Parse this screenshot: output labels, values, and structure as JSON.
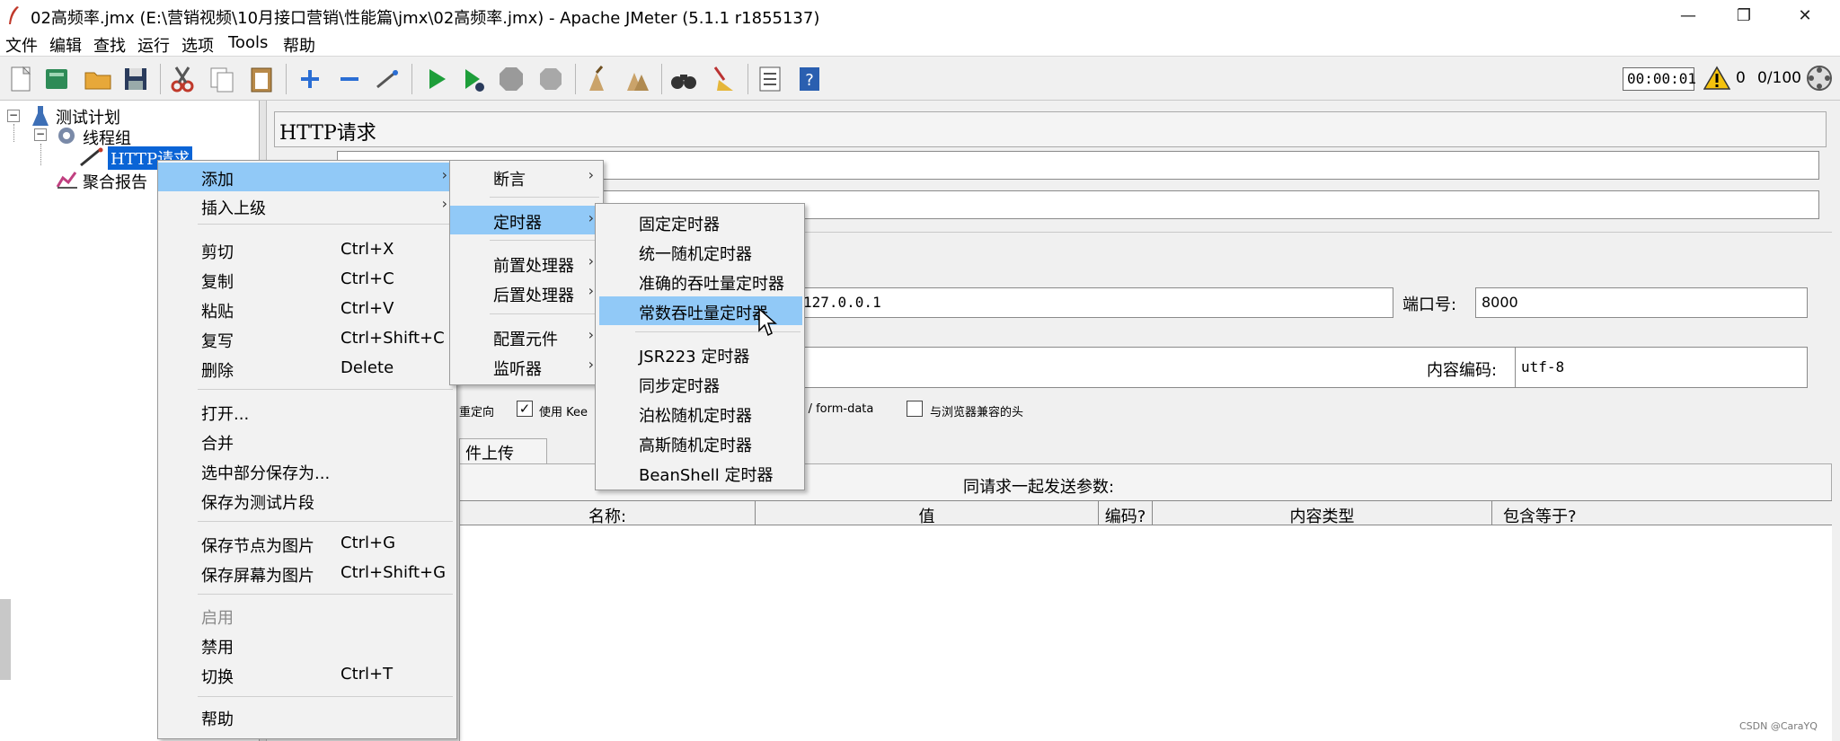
{
  "window": {
    "title": "02高频率.jmx (E:\\营销视频\\10月接口营销\\性能篇\\jmx\\02高频率.jmx) - Apache JMeter (5.1.1 r1855137)",
    "minimize": "—",
    "maximize": "❐",
    "close": "✕"
  },
  "menubar": [
    "文件",
    "编辑",
    "查找",
    "运行",
    "选项",
    "Tools",
    "帮助"
  ],
  "toolbar": {
    "timer": "00:00:01",
    "warning_count": "0",
    "threads": "0/100"
  },
  "tree": {
    "plan": "测试计划",
    "thread_group": "线程组",
    "http_request": "HTTP请求",
    "report": "聚合报告",
    "expander": "−"
  },
  "http_panel": {
    "title": "HTTP请求",
    "server_value": "127.0.0.1",
    "port_label": "端口号:",
    "port_value": "8000",
    "encoding_label": "内容编码:",
    "encoding_value": "utf-8",
    "redirect_label": "重定向",
    "keepalive_label": "使用 Kee",
    "multipart_label": "rt / form-data",
    "browser_headers_label": "与浏览器兼容的头",
    "upload_tab": "件上传",
    "params_caption": "同请求一起发送参数:",
    "columns": [
      "名称:",
      "值",
      "编码?",
      "内容类型",
      "包含等于?"
    ]
  },
  "context_menu": {
    "items": [
      {
        "label": "添加",
        "shortcut": "",
        "arrow": "›"
      },
      {
        "label": "插入上级",
        "shortcut": "",
        "arrow": "›"
      },
      {
        "label": "剪切",
        "shortcut": "Ctrl+X"
      },
      {
        "label": "复制",
        "shortcut": "Ctrl+C"
      },
      {
        "label": "粘贴",
        "shortcut": "Ctrl+V"
      },
      {
        "label": "复写",
        "shortcut": "Ctrl+Shift+C"
      },
      {
        "label": "删除",
        "shortcut": "Delete"
      },
      {
        "label": "打开..."
      },
      {
        "label": "合并"
      },
      {
        "label": "选中部分保存为..."
      },
      {
        "label": "保存为测试片段"
      },
      {
        "label": "保存节点为图片",
        "shortcut": "Ctrl+G"
      },
      {
        "label": "保存屏幕为图片",
        "shortcut": "Ctrl+Shift+G"
      },
      {
        "label": "启用"
      },
      {
        "label": "禁用"
      },
      {
        "label": "切换",
        "shortcut": "Ctrl+T"
      },
      {
        "label": "帮助"
      }
    ]
  },
  "add_submenu": {
    "items": [
      {
        "label": "断言",
        "arrow": "›"
      },
      {
        "label": "定时器",
        "arrow": "›"
      },
      {
        "label": "前置处理器",
        "arrow": "›"
      },
      {
        "label": "后置处理器",
        "arrow": "›"
      },
      {
        "label": "配置元件",
        "arrow": "›"
      },
      {
        "label": "监听器",
        "arrow": "›"
      }
    ]
  },
  "timer_submenu": {
    "items": [
      "固定定时器",
      "统一随机定时器",
      "准确的吞吐量定时器",
      "常数吞吐量定时器",
      "JSR223 定时器",
      "同步定时器",
      "泊松随机定时器",
      "高斯随机定时器",
      "BeanShell 定时器"
    ]
  },
  "watermark": "CSDN @CaraYQ",
  "colors": {
    "menu_highlight": "#91c9f7",
    "tree_selection": "#0a64d6",
    "run_green": "#1e9e3a"
  }
}
